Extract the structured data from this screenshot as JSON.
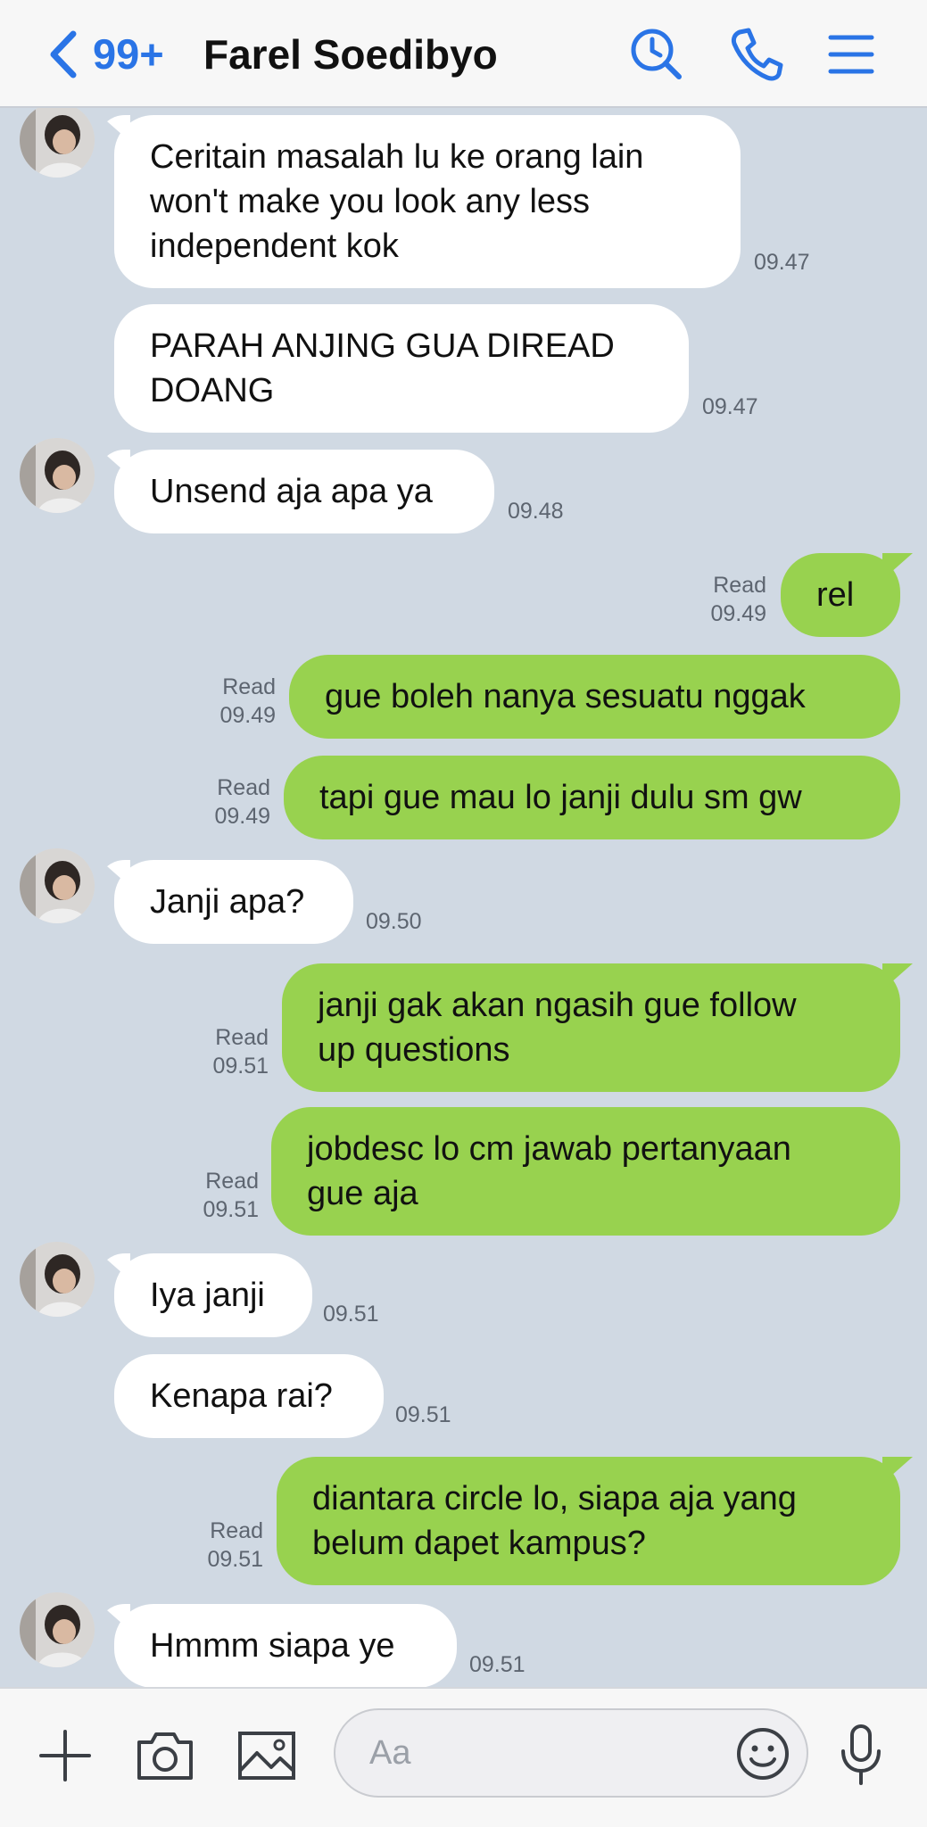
{
  "header": {
    "back_icon": "chevron-left-icon",
    "unread_count": "99+",
    "contact_name": "Farel Soedibyo",
    "icons": [
      "search-icon",
      "phone-icon",
      "menu-icon"
    ]
  },
  "messages": [
    {
      "dir": "in",
      "lines": [
        "Ceritain masalah lu ke orang lain",
        "won't make you look any less",
        "independent kok"
      ],
      "time": "09.47"
    },
    {
      "dir": "in",
      "lines": [
        "PARAH ANJING GUA DIREAD",
        "DOANG"
      ],
      "time": "09.47"
    },
    {
      "dir": "in",
      "lines": [
        "Unsend aja apa ya"
      ],
      "time": "09.48"
    },
    {
      "dir": "out",
      "lines": [
        "rel"
      ],
      "status": "Read",
      "time": "09.49"
    },
    {
      "dir": "out",
      "lines": [
        "gue boleh nanya sesuatu nggak"
      ],
      "status": "Read",
      "time": "09.49"
    },
    {
      "dir": "out",
      "lines": [
        "tapi gue mau lo janji dulu sm gw"
      ],
      "status": "Read",
      "time": "09.49"
    },
    {
      "dir": "in",
      "lines": [
        "Janji apa?"
      ],
      "time": "09.50"
    },
    {
      "dir": "out",
      "lines": [
        "janji gak akan ngasih gue follow",
        "up questions"
      ],
      "status": "Read",
      "time": "09.51"
    },
    {
      "dir": "out",
      "lines": [
        "jobdesc lo cm jawab pertanyaan",
        "gue aja"
      ],
      "status": "Read",
      "time": "09.51"
    },
    {
      "dir": "in",
      "lines": [
        "Iya janji"
      ],
      "time": "09.51"
    },
    {
      "dir": "in",
      "lines": [
        "Kenapa rai?"
      ],
      "time": "09.51"
    },
    {
      "dir": "out",
      "lines": [
        "diantara circle lo, siapa aja yang",
        "belum dapet kampus?"
      ],
      "status": "Read",
      "time": "09.51"
    },
    {
      "dir": "in",
      "lines": [
        "Hmmm siapa ye"
      ],
      "time": "09.51"
    }
  ],
  "composer": {
    "placeholder": "Aa",
    "icons": [
      "plus-icon",
      "camera-icon",
      "image-icon",
      "emoji-icon",
      "microphone-icon"
    ]
  },
  "colors": {
    "accent": "#2a74e6",
    "outgoing_bubble": "#98d24f",
    "incoming_bubble": "#ffffff",
    "chat_background": "#d0d9e3"
  }
}
